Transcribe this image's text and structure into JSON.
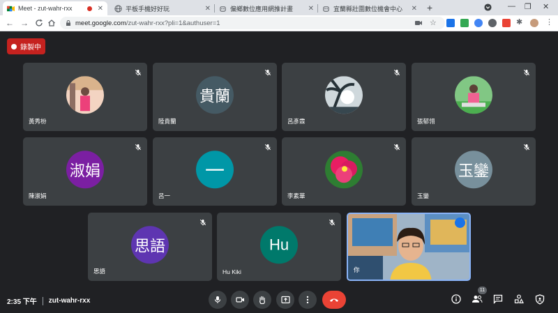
{
  "browser": {
    "tabs": [
      {
        "title": "Meet - zut-wahr-rxx",
        "active": true,
        "recording": true
      },
      {
        "title": "平板手機好好玩",
        "active": false
      },
      {
        "title": "偏鄉數位應用網推計畫",
        "active": false
      },
      {
        "title": "宜蘭縣壯圍數位機會中心",
        "active": false
      }
    ],
    "url_host": "meet.google.com",
    "url_rest": "/zut-wahr-rxx?pli=1&authuser=1"
  },
  "meeting": {
    "recording_label": "錄製中",
    "time": "2:35 下午",
    "code": "zut-wahr-rxx",
    "participant_count": "11"
  },
  "participants": [
    {
      "name": "黃秀枌",
      "avatar_text": "",
      "avatar_kind": "photo-pink",
      "muted": true
    },
    {
      "name": "陸貴蘭",
      "avatar_text": "貴蘭",
      "avatar_color": "#455a64",
      "muted": true
    },
    {
      "name": "呂彥霖",
      "avatar_text": "",
      "avatar_kind": "photo-palm",
      "muted": true
    },
    {
      "name": "張郁翎",
      "avatar_text": "",
      "avatar_kind": "photo-garden",
      "muted": true
    },
    {
      "name": "陳淑娟",
      "avatar_text": "淑娟",
      "avatar_color": "#7b1fa2",
      "muted": true
    },
    {
      "name": "呂一",
      "avatar_text": "一",
      "avatar_color": "#0097a7",
      "muted": true
    },
    {
      "name": "李素華",
      "avatar_text": "",
      "avatar_kind": "photo-flower",
      "muted": true
    },
    {
      "name": "玉鑾",
      "avatar_text": "玉鑾",
      "avatar_color": "#78909c",
      "muted": true
    },
    {
      "name": "思語",
      "avatar_text": "思語",
      "avatar_color": "#5e35b1",
      "muted": true
    },
    {
      "name": "Hu Kiki",
      "avatar_text": "Hu",
      "avatar_color": "#00796b",
      "muted": true
    },
    {
      "name": "你",
      "avatar_text": "",
      "avatar_kind": "video-self",
      "muted": false
    }
  ],
  "controls": {
    "mic": "mic-icon",
    "camera": "camera-icon",
    "hand": "raise-hand-icon",
    "present": "present-icon",
    "more": "more-icon",
    "leave": "end-call-icon"
  },
  "colors": {
    "background": "#202124",
    "tile": "#3c4043",
    "recording": "#c5221f",
    "leave": "#ea4335",
    "speaking_border": "#8ab4f8"
  }
}
